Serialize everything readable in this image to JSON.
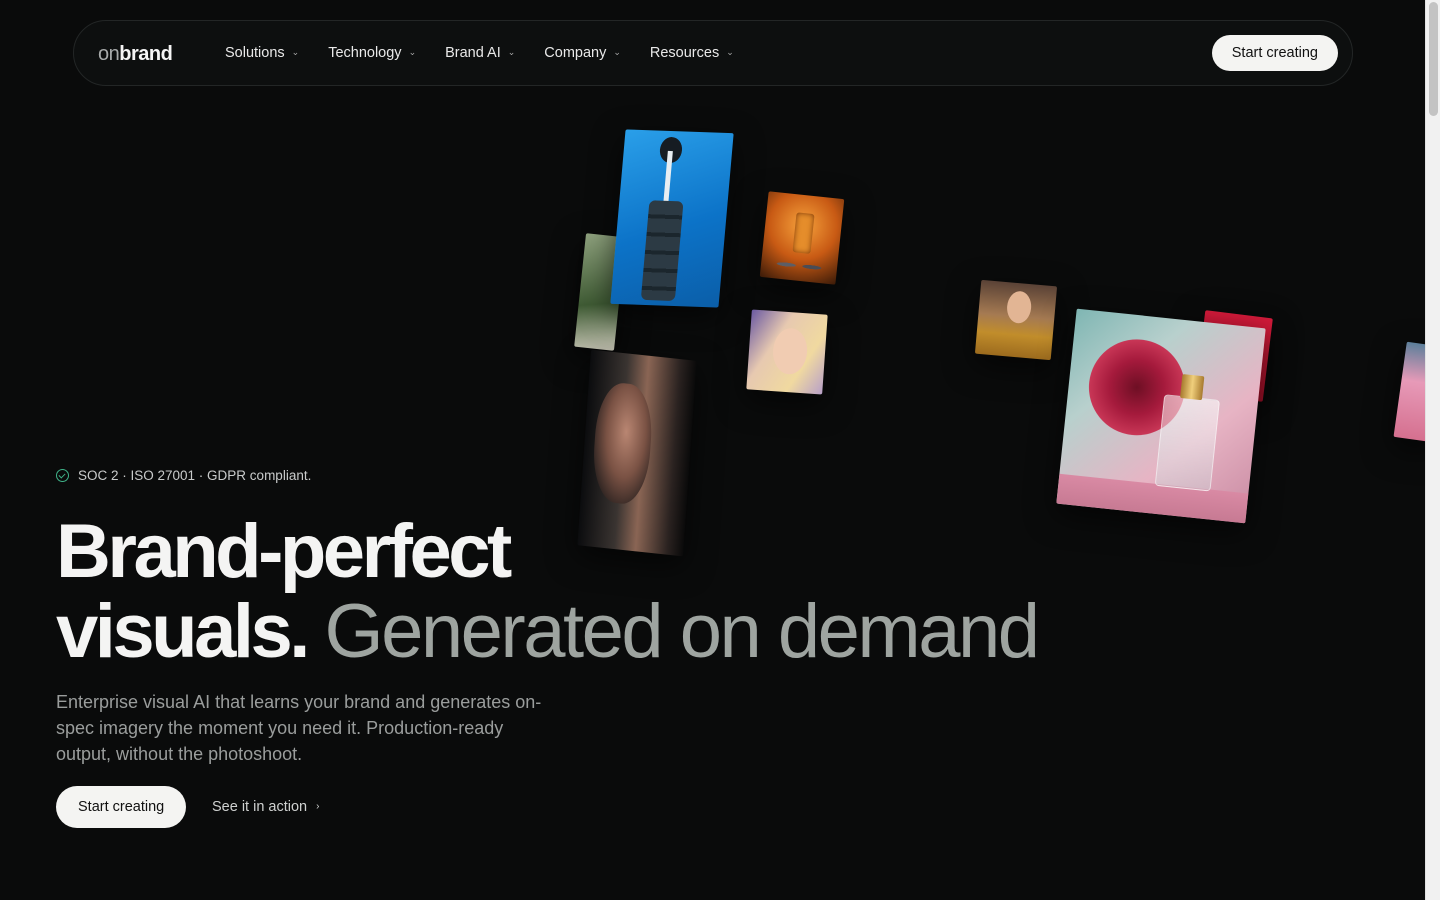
{
  "nav": {
    "logo_on": "on",
    "logo_brand": "brand",
    "items": [
      {
        "label": "Solutions"
      },
      {
        "label": "Technology"
      },
      {
        "label": "Brand AI"
      },
      {
        "label": "Company"
      },
      {
        "label": "Resources"
      }
    ],
    "cta_label": "Start creating"
  },
  "hero": {
    "badge": "SOC 2 · ISO 27001 · GDPR compliant.",
    "headline_strong_1": "Brand-perfect",
    "headline_strong_2": "visuals.",
    "headline_muted": "Generated on demand",
    "subcopy": "Enterprise visual AI that learns your brand and generates on-spec imagery the moment you need it. Production-ready output, without the photoshoot.",
    "primary_cta": "Start creating",
    "secondary_cta": "See it in action"
  },
  "colors": {
    "background": "#0a0b0b",
    "accent_check": "#3fb389",
    "button_bg": "#f4f4f2",
    "muted_text": "#9ea4a0"
  }
}
